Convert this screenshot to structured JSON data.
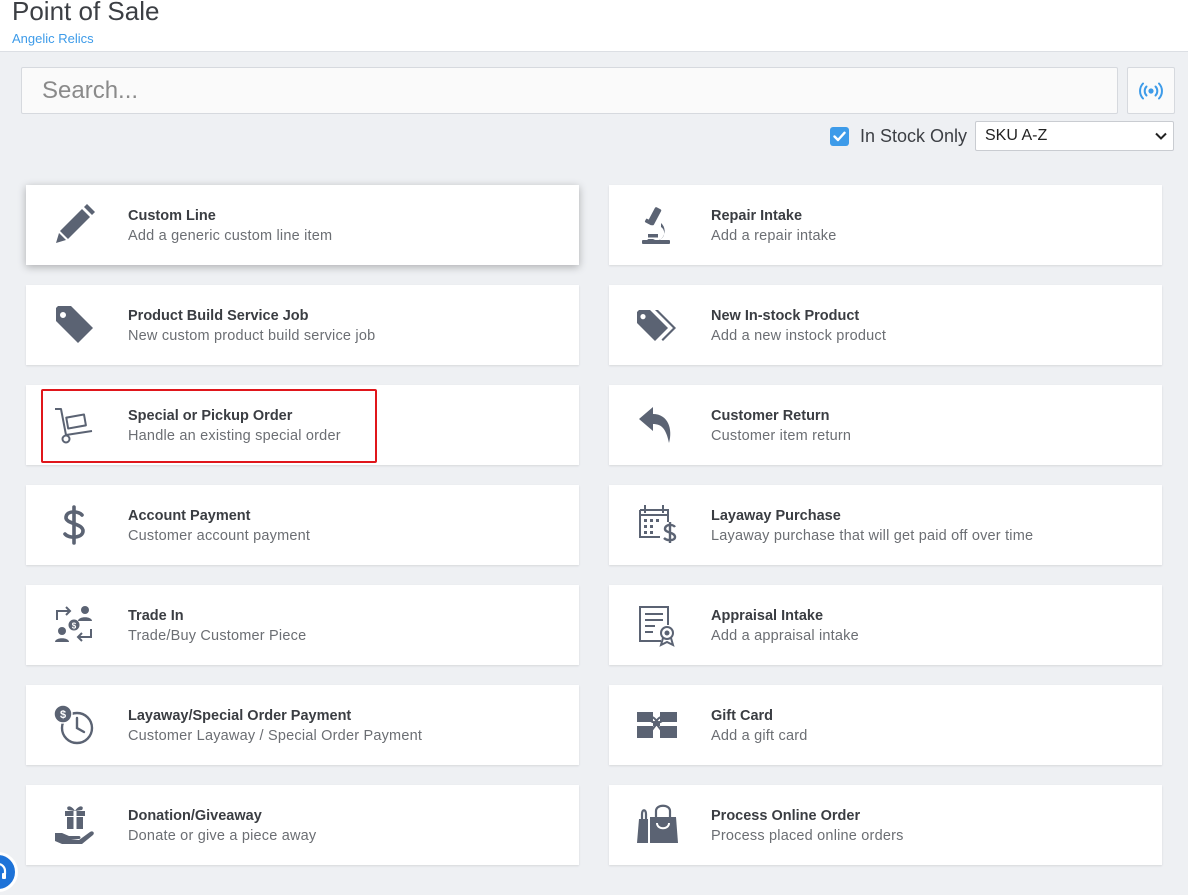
{
  "header": {
    "title": "Point of Sale",
    "store_name": "Angelic Relics"
  },
  "search": {
    "placeholder": "Search...",
    "rfid_icon": "broadcast-icon"
  },
  "filters": {
    "in_stock_label": "In Stock Only",
    "in_stock_checked": true,
    "sort_value": "SKU A-Z"
  },
  "colors": {
    "accent": "#3d9be9",
    "icon": "#5b6373",
    "highlight": "#e0161b"
  },
  "cards": [
    {
      "title": "Custom Line",
      "subtitle": "Add a generic custom line item",
      "icon": "pencil-icon"
    },
    {
      "title": "Repair Intake",
      "subtitle": "Add a repair intake",
      "icon": "microscope-icon"
    },
    {
      "title": "Product Build Service Job",
      "subtitle": "New custom product build service job",
      "icon": "tag-icon"
    },
    {
      "title": "New In-stock Product",
      "subtitle": "Add a new instock product",
      "icon": "tags-icon"
    },
    {
      "title": "Special or Pickup Order",
      "subtitle": "Handle an existing special order",
      "icon": "hand-truck-icon"
    },
    {
      "title": "Customer Return",
      "subtitle": "Customer item return",
      "icon": "reply-arrow-icon"
    },
    {
      "title": "Account Payment",
      "subtitle": "Customer account payment",
      "icon": "dollar-icon"
    },
    {
      "title": "Layaway Purchase",
      "subtitle": "Layaway purchase that will get paid off over time",
      "icon": "calendar-dollar-icon"
    },
    {
      "title": "Trade In",
      "subtitle": "Trade/Buy Customer Piece",
      "icon": "trade-exchange-icon"
    },
    {
      "title": "Appraisal Intake",
      "subtitle": "Add a appraisal intake",
      "icon": "certificate-icon"
    },
    {
      "title": "Layaway/Special Order Payment",
      "subtitle": "Customer Layaway / Special Order Payment",
      "icon": "dollar-clock-icon"
    },
    {
      "title": "Gift Card",
      "subtitle": "Add a gift card",
      "icon": "gift-card-icon"
    },
    {
      "title": "Donation/Giveaway",
      "subtitle": "Donate or give a piece away",
      "icon": "hand-gift-icon"
    },
    {
      "title": "Process Online Order",
      "subtitle": "Process placed online orders",
      "icon": "shopping-bag-icon"
    }
  ]
}
